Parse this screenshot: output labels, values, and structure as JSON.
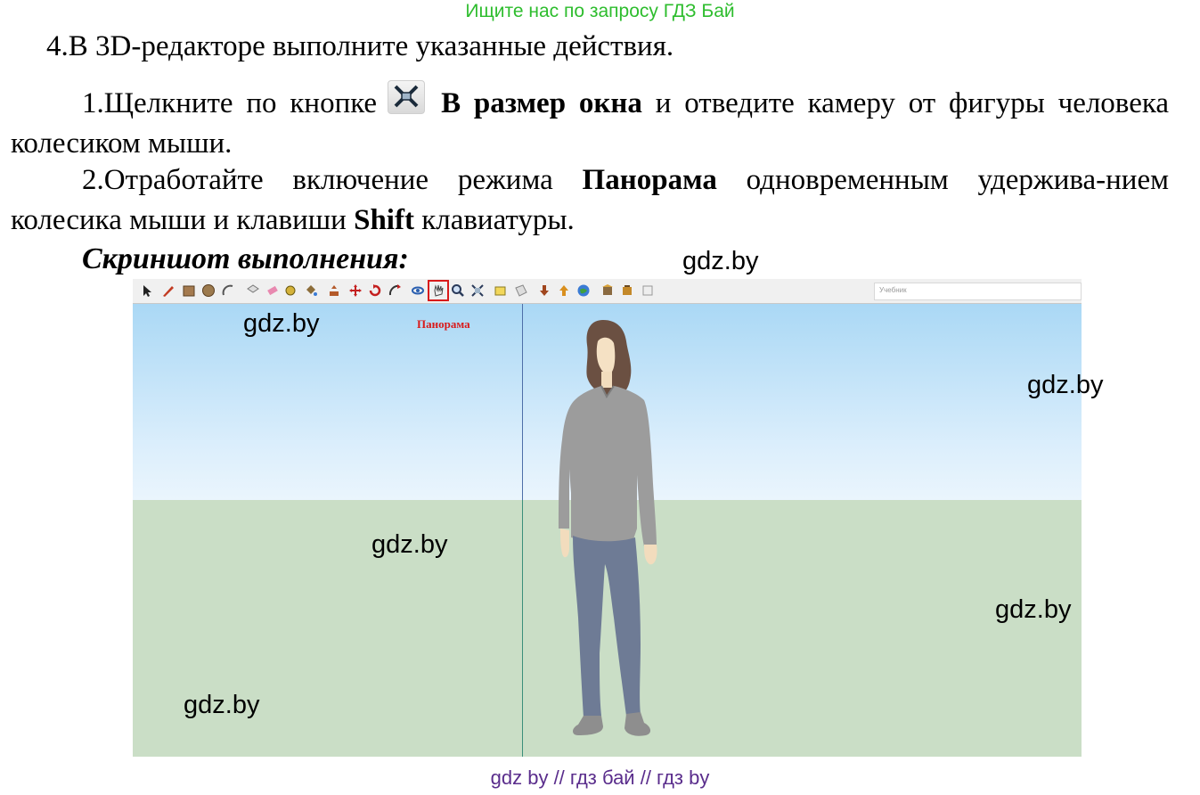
{
  "header": {
    "banner": "Ищите нас по запросу ГДЗ Бай"
  },
  "task": {
    "title": "4.В 3D-редакторе выполните указанные действия.",
    "step1": {
      "a": "1.Щелкните по кнопке",
      "bold": "В размер окна",
      "b": "и отведите камеру от фигуры человека колесиком мыши."
    },
    "step2": {
      "a": "2.Отработайте включение режима",
      "bold1": "Панорама",
      "b": "одновременным удержива-нием колесика мыши и клавиши",
      "bold2": "Shift",
      "c": "клавиатуры."
    },
    "screenshot_title": "Скриншот выполнения:"
  },
  "screenshot": {
    "search_placeholder": "Учебник",
    "panorama_label": "Панорама",
    "highlighted_tool": "pan-icon"
  },
  "watermarks": [
    "gdz.by",
    "gdz.by",
    "gdz.by",
    "gdz.by",
    "gdz.by",
    "gdz.by"
  ],
  "footer": {
    "text": "gdz by  //  гдз бай  //  гдз by"
  },
  "colors": {
    "banner": "#2ebd2e",
    "footer": "#5a2d8c",
    "highlight": "#d91a1a",
    "sky": "#aad8f5",
    "ground": "#cadec6"
  }
}
